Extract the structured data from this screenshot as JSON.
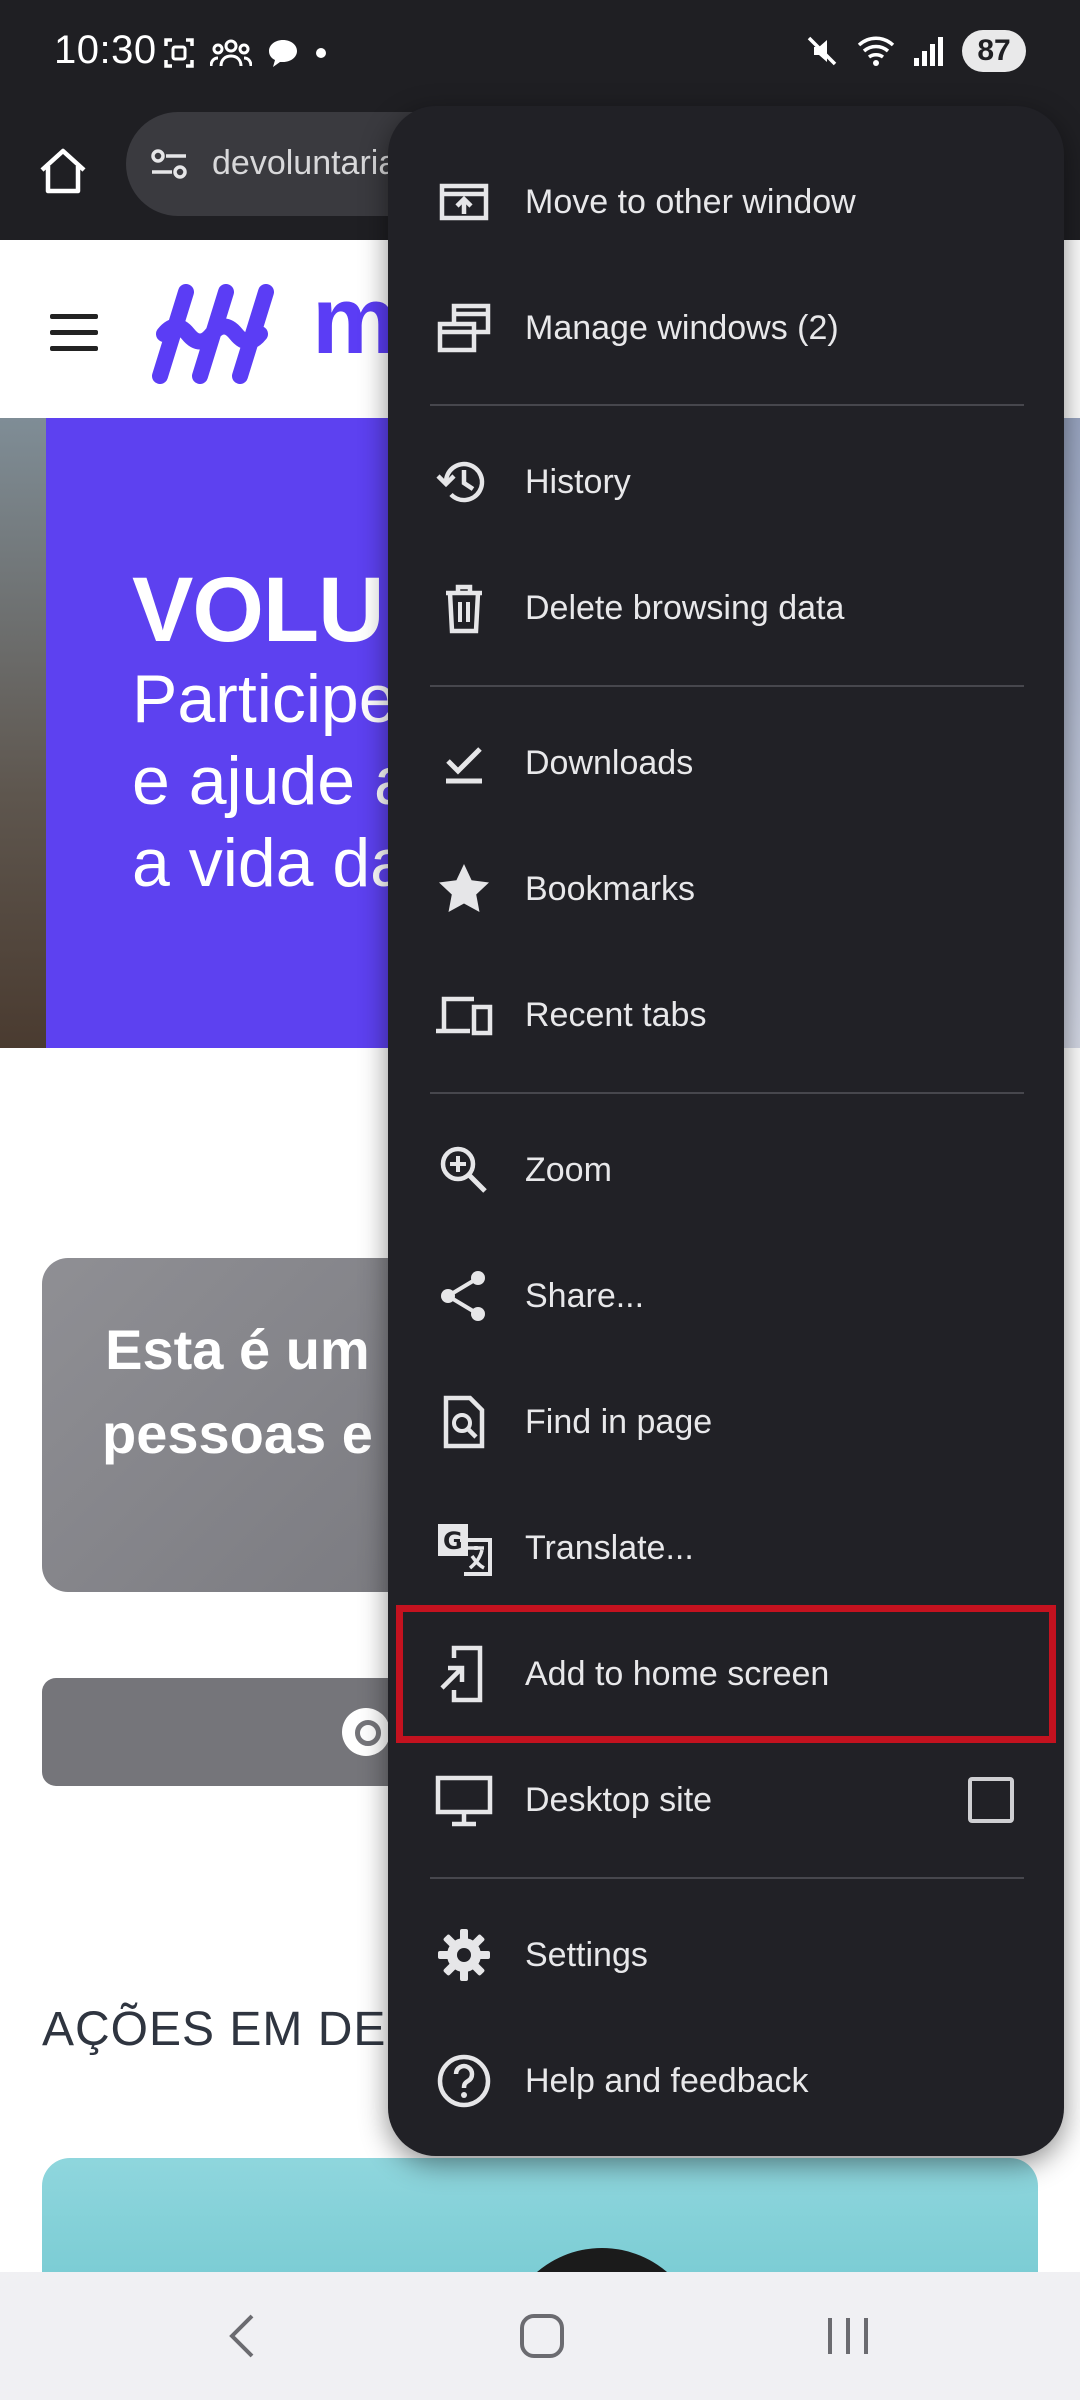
{
  "status_bar": {
    "time": "10:30",
    "battery": "87"
  },
  "toolbar": {
    "url": "devoluntaria"
  },
  "page": {
    "logo_text": "m",
    "hero_title": "VOLU",
    "hero_line1": "Participe",
    "hero_line2": "e ajude a",
    "hero_line3": "a vida da",
    "card_line1": "Esta é um",
    "card_line2": "pessoas e",
    "section_title": "AÇÕES EM DES"
  },
  "menu": {
    "items": [
      {
        "label": "Move to other window",
        "icon": "move-window-icon"
      },
      {
        "label": "Manage windows (2)",
        "icon": "windows-icon"
      },
      {
        "label": "History",
        "icon": "history-icon"
      },
      {
        "label": "Delete browsing data",
        "icon": "trash-icon"
      },
      {
        "label": "Downloads",
        "icon": "download-icon"
      },
      {
        "label": "Bookmarks",
        "icon": "star-icon"
      },
      {
        "label": "Recent tabs",
        "icon": "devices-icon"
      },
      {
        "label": "Zoom",
        "icon": "zoom-icon"
      },
      {
        "label": "Share...",
        "icon": "share-icon"
      },
      {
        "label": "Find in page",
        "icon": "find-in-page-icon"
      },
      {
        "label": "Translate...",
        "icon": "translate-icon"
      },
      {
        "label": "Add to home screen",
        "icon": "add-to-home-icon"
      },
      {
        "label": "Desktop site",
        "icon": "monitor-icon",
        "checked": false
      },
      {
        "label": "Settings",
        "icon": "gear-icon"
      },
      {
        "label": "Help and feedback",
        "icon": "help-icon"
      }
    ],
    "highlight_color": "#c4121f"
  }
}
